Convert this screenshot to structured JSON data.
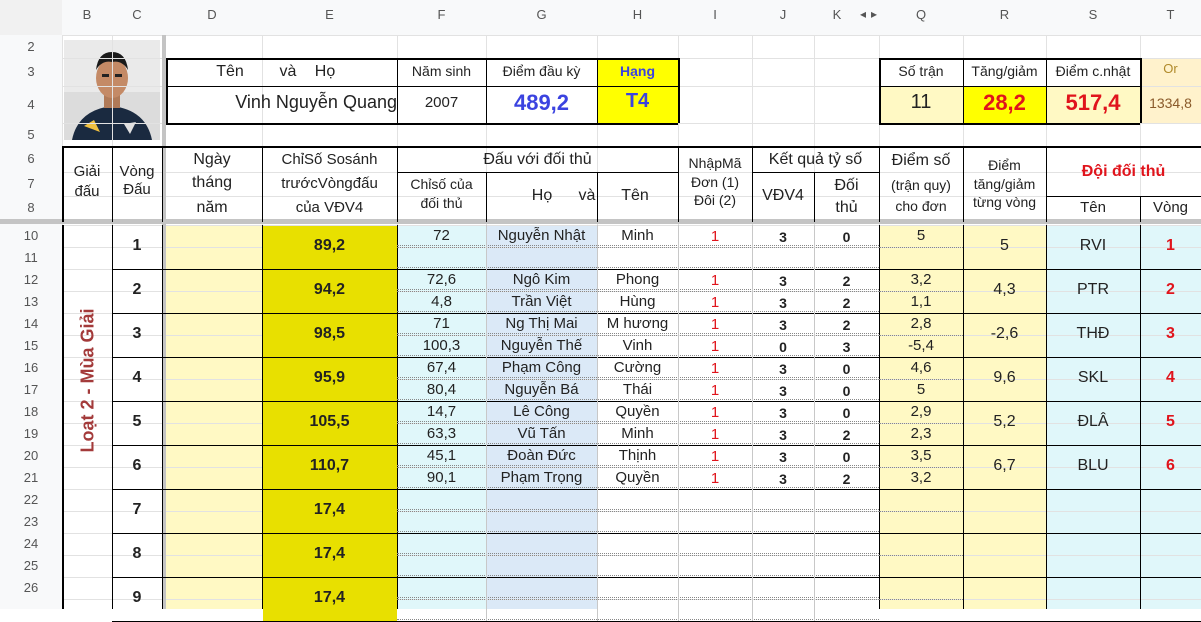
{
  "columns": [
    "B",
    "C",
    "D",
    "E",
    "F",
    "G",
    "H",
    "I",
    "J",
    "K",
    "Q",
    "R",
    "S",
    "T"
  ],
  "hidden_columns_arrows": [
    "◂",
    "▸"
  ],
  "rows": [
    "2",
    "3",
    "4",
    "5",
    "6",
    "7",
    "8",
    "10",
    "11",
    "12",
    "13",
    "14",
    "15",
    "16",
    "17",
    "18",
    "19",
    "20",
    "21",
    "22",
    "23",
    "24",
    "25",
    "26"
  ],
  "player": {
    "name_header_parts": [
      "Tên",
      "và",
      "Họ"
    ],
    "name": "Vinh Nguyễn Quang",
    "birth_year_label": "Năm sinh",
    "birth_year": "2007",
    "start_points_label": "Điểm đầu kỳ",
    "start_points": "489,2",
    "rank_label": "Hạng",
    "rank": "T4",
    "matches_label": "Số trận",
    "matches": "11",
    "change_label": "Tăng/giảm",
    "change": "28,2",
    "updated_label": "Điểm c.nhật",
    "updated": "517,4",
    "or_label": "Or",
    "or_value": "1334,8"
  },
  "table_headers": {
    "tournament": [
      "Giải",
      "đấu"
    ],
    "round": [
      "Vòng",
      "Đấu"
    ],
    "date": [
      "Ngày",
      "tháng",
      "năm"
    ],
    "index_before": [
      "ChỉSố Sosánh",
      "trướcVòngđấu",
      "của VĐV4"
    ],
    "vs_opponent": "Đấu với đối thủ",
    "opp_index": [
      "Chỉsố của",
      "đối thủ"
    ],
    "name_cols": [
      "Họ",
      "và",
      "Tên"
    ],
    "entry_code": [
      "NhậpMã",
      "Đơn (1)",
      "Đôi (2)"
    ],
    "score_result": "Kết quả tỷ số",
    "vdv4": "VĐV4",
    "opponent": [
      "Đối",
      "thủ"
    ],
    "points": [
      "Điểm số",
      "(trận quy)",
      "cho đơn"
    ],
    "round_change": [
      "Điểm",
      "tăng/giảm",
      "từng vòng"
    ],
    "opp_team": "Đội đối thủ",
    "team_name": "Tên",
    "team_round": "Vòng"
  },
  "season_label": "Loạt 2 - Mùa Giải",
  "rounds": [
    {
      "round": "1",
      "index": "89,2",
      "change": "5",
      "team": "RVI",
      "team_round": "1",
      "matches": [
        {
          "opp_index": "72",
          "last": "Nguyễn Nhật",
          "first": "Minh",
          "code": "1",
          "s1": "3",
          "s2": "0",
          "pts": "5"
        }
      ]
    },
    {
      "round": "2",
      "index": "94,2",
      "change": "4,3",
      "team": "PTR",
      "team_round": "2",
      "matches": [
        {
          "opp_index": "72,6",
          "last": "Ngô Kim",
          "first": "Phong",
          "code": "1",
          "s1": "3",
          "s2": "2",
          "pts": "3,2"
        },
        {
          "opp_index": "4,8",
          "last": "Trần Việt",
          "first": "Hùng",
          "code": "1",
          "s1": "3",
          "s2": "2",
          "pts": "1,1"
        }
      ]
    },
    {
      "round": "3",
      "index": "98,5",
      "change": "-2,6",
      "team": "THĐ",
      "team_round": "3",
      "matches": [
        {
          "opp_index": "71",
          "last": "Ng Thị Mai",
          "first": "M hương",
          "code": "1",
          "s1": "3",
          "s2": "2",
          "pts": "2,8"
        },
        {
          "opp_index": "100,3",
          "last": "Nguyễn Thế",
          "first": "Vinh",
          "code": "1",
          "s1": "0",
          "s2": "3",
          "pts": "-5,4"
        }
      ]
    },
    {
      "round": "4",
      "index": "95,9",
      "change": "9,6",
      "team": "SKL",
      "team_round": "4",
      "matches": [
        {
          "opp_index": "67,4",
          "last": "Phạm Công",
          "first": "Cường",
          "code": "1",
          "s1": "3",
          "s2": "0",
          "pts": "4,6"
        },
        {
          "opp_index": "80,4",
          "last": "Nguyễn Bá",
          "first": "Thái",
          "code": "1",
          "s1": "3",
          "s2": "0",
          "pts": "5"
        }
      ]
    },
    {
      "round": "5",
      "index": "105,5",
      "change": "5,2",
      "team": "ĐLÂ",
      "team_round": "5",
      "matches": [
        {
          "opp_index": "14,7",
          "last": "Lê Công",
          "first": "Quyền",
          "code": "1",
          "s1": "3",
          "s2": "0",
          "pts": "2,9"
        },
        {
          "opp_index": "63,3",
          "last": "Vũ Tấn",
          "first": "Minh",
          "code": "1",
          "s1": "3",
          "s2": "2",
          "pts": "2,3"
        }
      ]
    },
    {
      "round": "6",
      "index": "110,7",
      "change": "6,7",
      "team": "BLU",
      "team_round": "6",
      "matches": [
        {
          "opp_index": "45,1",
          "last": "Đoàn Đức",
          "first": "Thịnh",
          "code": "1",
          "s1": "3",
          "s2": "0",
          "pts": "3,5"
        },
        {
          "opp_index": "90,1",
          "last": "Phạm Trọng",
          "first": "Quyền",
          "code": "1",
          "s1": "3",
          "s2": "2",
          "pts": "3,2"
        }
      ]
    },
    {
      "round": "7",
      "index": "17,4",
      "change": "",
      "team": "",
      "team_round": "",
      "matches": []
    },
    {
      "round": "8",
      "index": "17,4",
      "change": "",
      "team": "",
      "team_round": "",
      "matches": []
    },
    {
      "round": "9",
      "index": "17,4",
      "change": "",
      "team": "",
      "team_round": "",
      "matches": []
    }
  ],
  "colors": {
    "grid": "#e2e2e2",
    "black": "#000000",
    "yellow": "#ffff00",
    "light_yellow": "#ffff99",
    "pale_yellow": "#fff9c4",
    "cream": "#fff2cc",
    "blue_text": "#3b43e0",
    "red_text": "#e0141c",
    "maroon": "#a33a3a",
    "light_cyan": "#e0f7fa",
    "light_blue": "#dbe9f7",
    "header_bg": "#f8f9fa",
    "frozen": "#c4c4c4",
    "dark_yellow": "#e8e000",
    "vivid_yellow": "#ffff33"
  }
}
